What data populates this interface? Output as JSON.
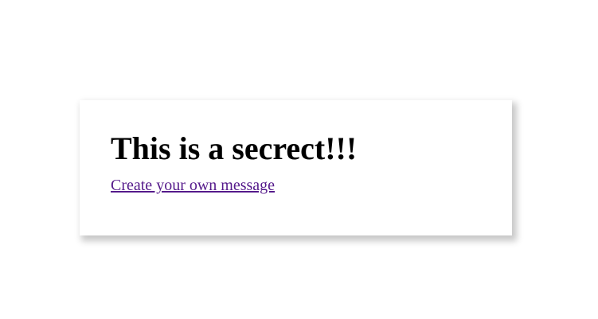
{
  "card": {
    "heading": "This is a secrect!!!",
    "link_label": "Create your own message",
    "link_color": "#551a8b"
  }
}
